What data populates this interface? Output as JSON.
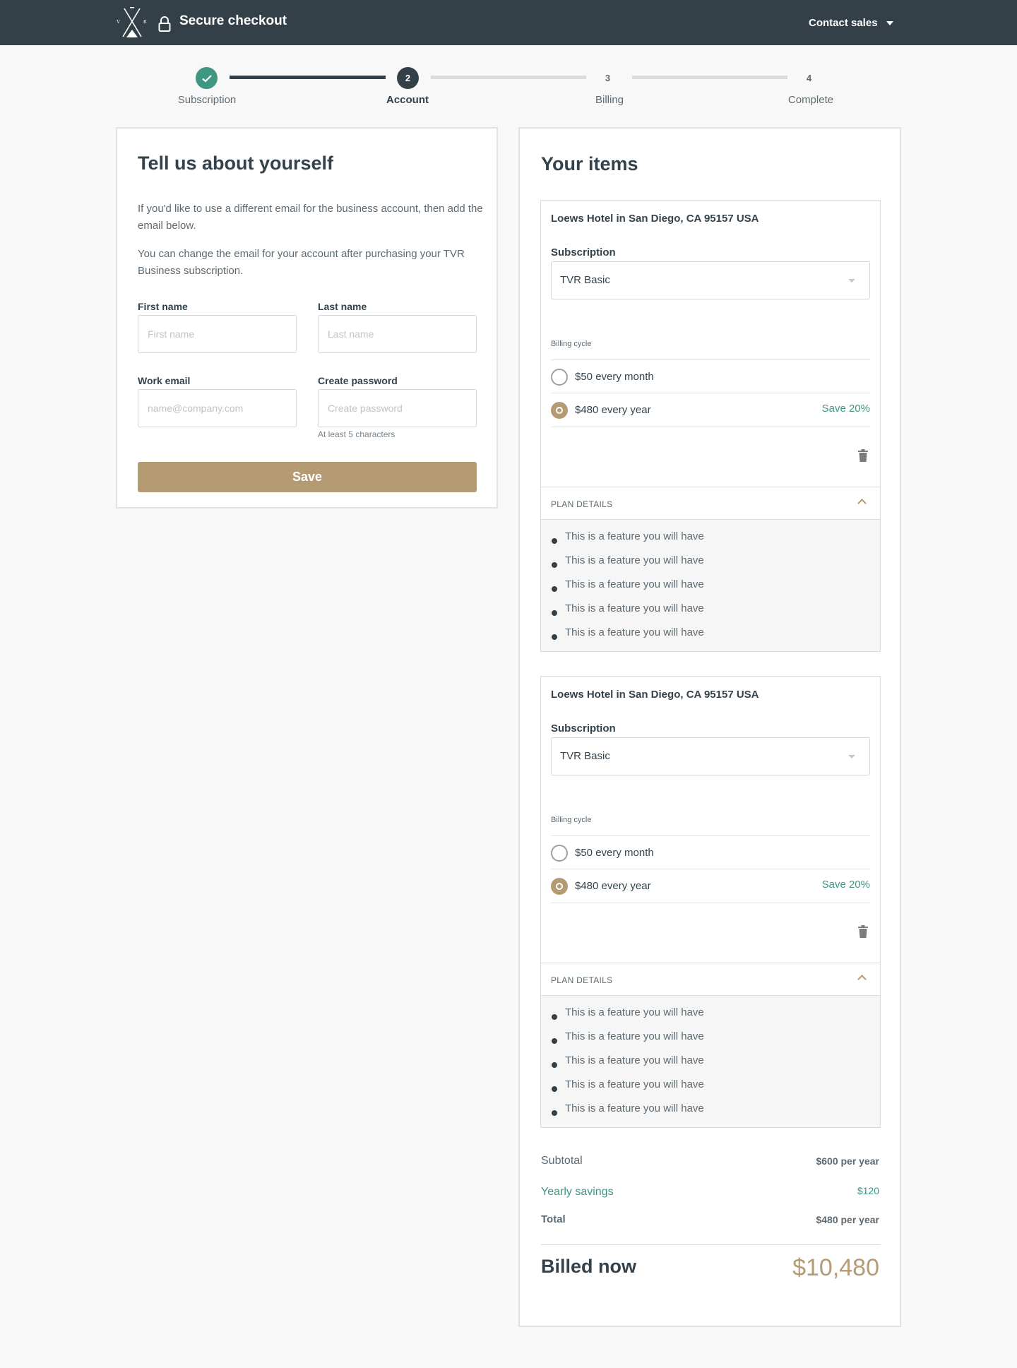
{
  "header": {
    "brand_title": "Secure checkout",
    "contact": "Contact sales",
    "logo_letters": [
      "V",
      "R"
    ]
  },
  "stepper": {
    "steps": [
      {
        "number": "",
        "label": "Subscription",
        "state": "done"
      },
      {
        "number": "2",
        "label": "Account",
        "state": "active"
      },
      {
        "number": "3",
        "label": "Billing",
        "state": "todo"
      },
      {
        "number": "4",
        "label": "Complete",
        "state": "todo"
      }
    ]
  },
  "account_form": {
    "title": "Tell us about yourself",
    "intro_1": "If you'd like to use a different email for the business account, then add the email below.",
    "intro_2": "You can change the email for your account after purchasing your TVR Business subscription.",
    "first_name_label": "First name",
    "first_name_placeholder": "First name",
    "first_name_value": "",
    "last_name_label": "Last name",
    "last_name_placeholder": "Last name",
    "last_name_value": "",
    "email_label": "Work email",
    "email_placeholder": "name@company.com",
    "email_value": "",
    "password_label": "Create password",
    "password_placeholder": "Create password",
    "password_value": "",
    "password_hint": "At least 5 characters",
    "save_label": "Save"
  },
  "items": {
    "title": "Your items",
    "list": [
      {
        "address": "Loews Hotel in San Diego, CA 95157 USA",
        "subscription_label": "Subscription",
        "subscription_value": "TVR Basic",
        "billing_cycle_label": "Billing cycle",
        "option_monthly": "$50 every month",
        "option_yearly": "$480 every year",
        "yearly_savings": "Save 20%",
        "selected": "yearly",
        "plan_details_label": "PLAN DETAILS",
        "features": [
          "This is a feature you will have",
          "This is a feature you will have",
          "This is a feature you will have",
          "This is a feature you will have",
          "This is a feature you will have"
        ]
      },
      {
        "address": "Loews Hotel in San Diego, CA 95157 USA",
        "subscription_label": "Subscription",
        "subscription_value": "TVR Basic",
        "billing_cycle_label": "Billing cycle",
        "option_monthly": "$50 every month",
        "option_yearly": "$480 every year",
        "yearly_savings": "Save 20%",
        "selected": "yearly",
        "plan_details_label": "PLAN DETAILS",
        "features": [
          "This is a feature you will have",
          "This is a feature you will have",
          "This is a feature you will have",
          "This is a feature you will have",
          "This is a feature you will have"
        ]
      }
    ]
  },
  "summary": {
    "subtotal_label": "Subtotal",
    "subtotal_value": "$600 per year",
    "savings_label": "Yearly savings",
    "savings_value": "$120",
    "total_label": "Total",
    "total_value": "$480 per year",
    "billed_label": "Billed now",
    "billed_value": "$10,480"
  },
  "colors": {
    "header_bg": "#344047",
    "accent_gold": "#b49b74",
    "success_green": "#3d9783",
    "text_dark": "#34424c"
  }
}
